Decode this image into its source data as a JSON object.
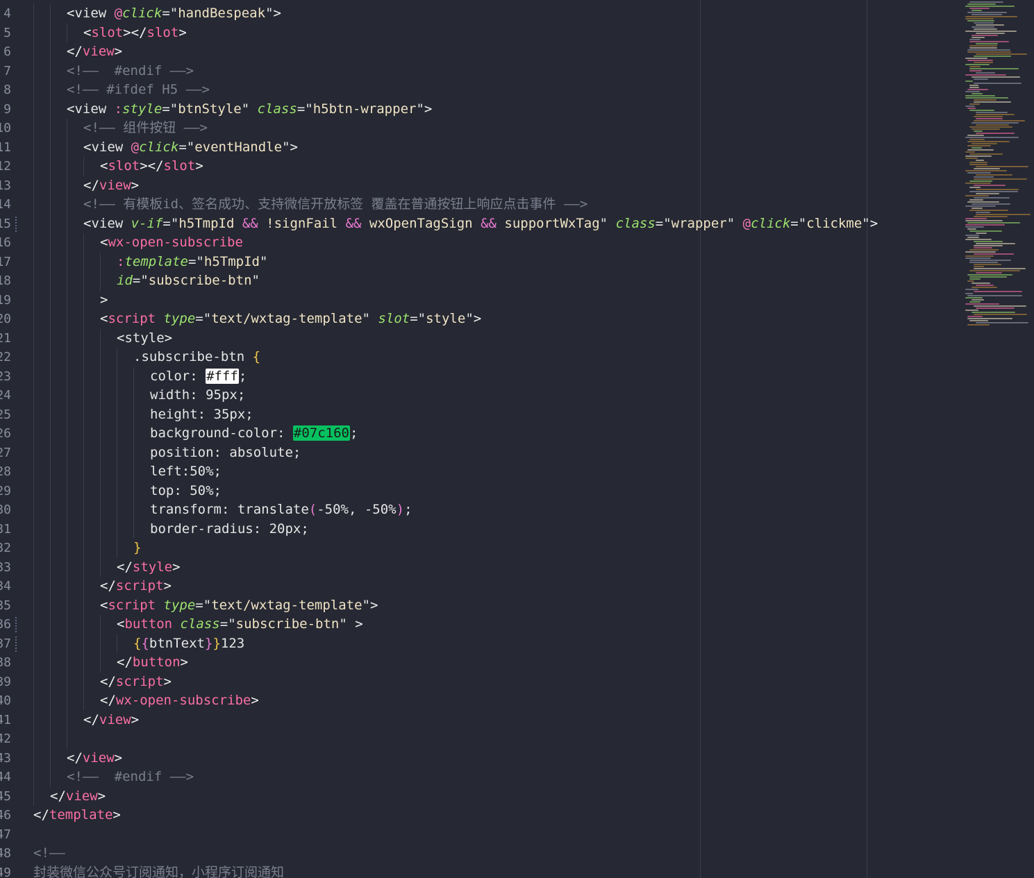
{
  "editor": {
    "lines": [
      {
        "n": "4",
        "indent": 2,
        "tokens": [
          [
            "tag",
            "<"
          ],
          [
            "tagname2",
            "view "
          ],
          [
            "pink",
            "@"
          ],
          [
            "attr",
            "click"
          ],
          [
            "eq",
            "="
          ],
          [
            "strq",
            "\""
          ],
          [
            "str",
            "handBespeak"
          ],
          [
            "strq",
            "\""
          ],
          [
            "tag",
            ">"
          ]
        ]
      },
      {
        "n": "5",
        "indent": 3,
        "tokens": [
          [
            "tag",
            "<"
          ],
          [
            "tagname",
            "slot"
          ],
          [
            "tag",
            "></"
          ],
          [
            "tagname",
            "slot"
          ],
          [
            "tag",
            ">"
          ]
        ]
      },
      {
        "n": "6",
        "indent": 2,
        "tokens": [
          [
            "tag",
            "</"
          ],
          [
            "tagname",
            "view"
          ],
          [
            "tag",
            ">"
          ]
        ]
      },
      {
        "n": "7",
        "indent": 2,
        "tokens": [
          [
            "comment",
            "<!——  #endif ——>"
          ]
        ]
      },
      {
        "n": "8",
        "indent": 2,
        "tokens": [
          [
            "comment",
            "<!—— #ifdef H5 ——>"
          ]
        ]
      },
      {
        "n": "9",
        "indent": 2,
        "tokens": [
          [
            "tag",
            "<"
          ],
          [
            "tagname2",
            "view "
          ],
          [
            "pink",
            ":"
          ],
          [
            "attr",
            "style"
          ],
          [
            "eq",
            "="
          ],
          [
            "strq",
            "\""
          ],
          [
            "str",
            "btnStyle"
          ],
          [
            "strq",
            "\" "
          ],
          [
            "attr",
            "class"
          ],
          [
            "eq",
            "="
          ],
          [
            "strq",
            "\""
          ],
          [
            "str",
            "h5btn-wrapper"
          ],
          [
            "strq",
            "\""
          ],
          [
            "tag",
            ">"
          ]
        ]
      },
      {
        "n": "10",
        "indent": 3,
        "tokens": [
          [
            "comment",
            "<!—— 组件按钮 ——>"
          ]
        ]
      },
      {
        "n": "11",
        "indent": 3,
        "tokens": [
          [
            "tag",
            "<"
          ],
          [
            "tagname2",
            "view "
          ],
          [
            "pink",
            "@"
          ],
          [
            "attr",
            "click"
          ],
          [
            "eq",
            "="
          ],
          [
            "strq",
            "\""
          ],
          [
            "str",
            "eventHandle"
          ],
          [
            "strq",
            "\""
          ],
          [
            "tag",
            ">"
          ]
        ]
      },
      {
        "n": "12",
        "indent": 4,
        "tokens": [
          [
            "tag",
            "<"
          ],
          [
            "tagname",
            "slot"
          ],
          [
            "tag",
            "></"
          ],
          [
            "tagname",
            "slot"
          ],
          [
            "tag",
            ">"
          ]
        ]
      },
      {
        "n": "13",
        "indent": 3,
        "tokens": [
          [
            "tag",
            "</"
          ],
          [
            "tagname",
            "view"
          ],
          [
            "tag",
            ">"
          ]
        ]
      },
      {
        "n": "14",
        "indent": 3,
        "tokens": [
          [
            "comment",
            "<!—— 有模板id、签名成功、支持微信开放标签 覆盖在普通按钮上响应点击事件 ——>"
          ]
        ]
      },
      {
        "n": "15",
        "indent": 3,
        "mod": true,
        "tokens": [
          [
            "tag",
            "<"
          ],
          [
            "tagname2",
            "view "
          ],
          [
            "attr",
            "v-if"
          ],
          [
            "eq",
            "="
          ],
          [
            "strq",
            "\""
          ],
          [
            "str",
            "h5TmpId "
          ],
          [
            "op",
            "&&"
          ],
          [
            "str",
            " !signFail "
          ],
          [
            "op",
            "&&"
          ],
          [
            "str",
            " wxOpenTagSign "
          ],
          [
            "op",
            "&&"
          ],
          [
            "str",
            " supportWxTag"
          ],
          [
            "strq",
            "\" "
          ],
          [
            "attr",
            "class"
          ],
          [
            "eq",
            "="
          ],
          [
            "strq",
            "\""
          ],
          [
            "str",
            "wrapper"
          ],
          [
            "strq",
            "\" "
          ],
          [
            "pink",
            "@"
          ],
          [
            "attr",
            "click"
          ],
          [
            "eq",
            "="
          ],
          [
            "strq",
            "\""
          ],
          [
            "str",
            "clickme"
          ],
          [
            "strq",
            "\""
          ],
          [
            "tag",
            ">"
          ]
        ]
      },
      {
        "n": "16",
        "indent": 4,
        "tokens": [
          [
            "tag",
            "<"
          ],
          [
            "tagname",
            "wx-open-subscribe"
          ]
        ]
      },
      {
        "n": "17",
        "indent": 5,
        "tokens": [
          [
            "pink",
            ":"
          ],
          [
            "attr",
            "template"
          ],
          [
            "eq",
            "="
          ],
          [
            "strq",
            "\""
          ],
          [
            "str",
            "h5TmpId"
          ],
          [
            "strq",
            "\""
          ]
        ]
      },
      {
        "n": "18",
        "indent": 5,
        "tokens": [
          [
            "attr",
            "id"
          ],
          [
            "eq",
            "="
          ],
          [
            "strq",
            "\""
          ],
          [
            "str",
            "subscribe-btn"
          ],
          [
            "strq",
            "\""
          ]
        ]
      },
      {
        "n": "19",
        "indent": 4,
        "tokens": [
          [
            "tag",
            ">"
          ]
        ]
      },
      {
        "n": "20",
        "indent": 4,
        "tokens": [
          [
            "tag",
            "<"
          ],
          [
            "tagname",
            "script "
          ],
          [
            "attr",
            "type"
          ],
          [
            "eq",
            "="
          ],
          [
            "strq",
            "\""
          ],
          [
            "str",
            "text/wxtag-template"
          ],
          [
            "strq",
            "\" "
          ],
          [
            "attr",
            "slot"
          ],
          [
            "eq",
            "="
          ],
          [
            "strq",
            "\""
          ],
          [
            "str",
            "style"
          ],
          [
            "strq",
            "\""
          ],
          [
            "tag",
            ">"
          ]
        ]
      },
      {
        "n": "21",
        "indent": 5,
        "tokens": [
          [
            "tag",
            "<"
          ],
          [
            "tagname2",
            "style"
          ],
          [
            "tag",
            ">"
          ]
        ]
      },
      {
        "n": "22",
        "indent": 6,
        "tokens": [
          [
            "sel",
            ".subscribe-btn "
          ],
          [
            "brace",
            "{"
          ]
        ]
      },
      {
        "n": "23",
        "indent": 7,
        "tokens": [
          [
            "sel",
            "color: "
          ],
          [
            "swatch-white",
            "#fff"
          ],
          [
            "sel",
            ";"
          ]
        ]
      },
      {
        "n": "24",
        "indent": 7,
        "tokens": [
          [
            "sel",
            "width: 95px;"
          ]
        ]
      },
      {
        "n": "25",
        "indent": 7,
        "tokens": [
          [
            "sel",
            "height: 35px;"
          ]
        ]
      },
      {
        "n": "26",
        "indent": 7,
        "tokens": [
          [
            "sel",
            "background-color: "
          ],
          [
            "swatch-green",
            "#07c160"
          ],
          [
            "sel",
            ";"
          ]
        ]
      },
      {
        "n": "27",
        "indent": 7,
        "tokens": [
          [
            "sel",
            "position: absolute;"
          ]
        ]
      },
      {
        "n": "28",
        "indent": 7,
        "tokens": [
          [
            "sel",
            "left:50%;"
          ]
        ]
      },
      {
        "n": "29",
        "indent": 7,
        "tokens": [
          [
            "sel",
            "top: 50%;"
          ]
        ]
      },
      {
        "n": "30",
        "indent": 7,
        "tokens": [
          [
            "sel",
            "transform: translate"
          ],
          [
            "paren",
            "("
          ],
          [
            "sel",
            "-50%, -50%"
          ],
          [
            "paren",
            ")"
          ],
          [
            "sel",
            ";"
          ]
        ]
      },
      {
        "n": "31",
        "indent": 7,
        "tokens": [
          [
            "sel",
            "border-radius: 20px;"
          ]
        ]
      },
      {
        "n": "32",
        "indent": 6,
        "tokens": [
          [
            "brace",
            "}"
          ]
        ]
      },
      {
        "n": "33",
        "indent": 5,
        "tokens": [
          [
            "tag",
            "</"
          ],
          [
            "tagname",
            "style"
          ],
          [
            "tag",
            ">"
          ]
        ]
      },
      {
        "n": "34",
        "indent": 4,
        "tokens": [
          [
            "tag",
            "</"
          ],
          [
            "tagname",
            "script"
          ],
          [
            "tag",
            ">"
          ]
        ]
      },
      {
        "n": "35",
        "indent": 4,
        "tokens": [
          [
            "tag",
            "<"
          ],
          [
            "tagname",
            "script "
          ],
          [
            "attr",
            "type"
          ],
          [
            "eq",
            "="
          ],
          [
            "strq",
            "\""
          ],
          [
            "str",
            "text/wxtag-template"
          ],
          [
            "strq",
            "\""
          ],
          [
            "tag",
            ">"
          ]
        ]
      },
      {
        "n": "36",
        "indent": 5,
        "mod": true,
        "tokens": [
          [
            "tag",
            "<"
          ],
          [
            "tagname",
            "button "
          ],
          [
            "attr",
            "class"
          ],
          [
            "eq",
            "="
          ],
          [
            "strq",
            "\""
          ],
          [
            "str",
            "subscribe-btn"
          ],
          [
            "strq",
            "\" "
          ],
          [
            "tag",
            ">"
          ]
        ]
      },
      {
        "n": "37",
        "indent": 6,
        "mod": true,
        "tokens": [
          [
            "brace",
            "{"
          ],
          [
            "paren",
            "{"
          ],
          [
            "sel",
            "btnText"
          ],
          [
            "paren",
            "}"
          ],
          [
            "brace",
            "}"
          ],
          [
            "sel",
            "123"
          ]
        ]
      },
      {
        "n": "38",
        "indent": 5,
        "tokens": [
          [
            "tag",
            "</"
          ],
          [
            "tagname",
            "button"
          ],
          [
            "tag",
            ">"
          ]
        ]
      },
      {
        "n": "39",
        "indent": 4,
        "tokens": [
          [
            "tag",
            "</"
          ],
          [
            "tagname",
            "script"
          ],
          [
            "tag",
            ">"
          ]
        ]
      },
      {
        "n": "40",
        "indent": 4,
        "tokens": [
          [
            "tag",
            "</"
          ],
          [
            "tagname",
            "wx-open-subscribe"
          ],
          [
            "tag",
            ">"
          ]
        ]
      },
      {
        "n": "41",
        "indent": 3,
        "tokens": [
          [
            "tag",
            "</"
          ],
          [
            "tagname",
            "view"
          ],
          [
            "tag",
            ">"
          ]
        ]
      },
      {
        "n": "42",
        "indent": 3,
        "tokens": []
      },
      {
        "n": "43",
        "indent": 2,
        "tokens": [
          [
            "tag",
            "</"
          ],
          [
            "tagname",
            "view"
          ],
          [
            "tag",
            ">"
          ]
        ]
      },
      {
        "n": "44",
        "indent": 2,
        "tokens": [
          [
            "comment",
            "<!——  #endif ——>"
          ]
        ]
      },
      {
        "n": "45",
        "indent": 1,
        "tokens": [
          [
            "tag",
            "</"
          ],
          [
            "tagname",
            "view"
          ],
          [
            "tag",
            ">"
          ]
        ]
      },
      {
        "n": "46",
        "indent": 0,
        "tokens": [
          [
            "tag",
            "</"
          ],
          [
            "tagname",
            "template"
          ],
          [
            "tag",
            ">"
          ]
        ]
      },
      {
        "n": "47",
        "indent": 0,
        "tokens": []
      },
      {
        "n": "48",
        "indent": 0,
        "tokens": [
          [
            "comment",
            "<!——"
          ]
        ]
      },
      {
        "n": "49",
        "indent": 0,
        "tokens": [
          [
            "comment",
            "封装微信公众号订阅通知，小程序订阅通知"
          ]
        ]
      }
    ]
  }
}
